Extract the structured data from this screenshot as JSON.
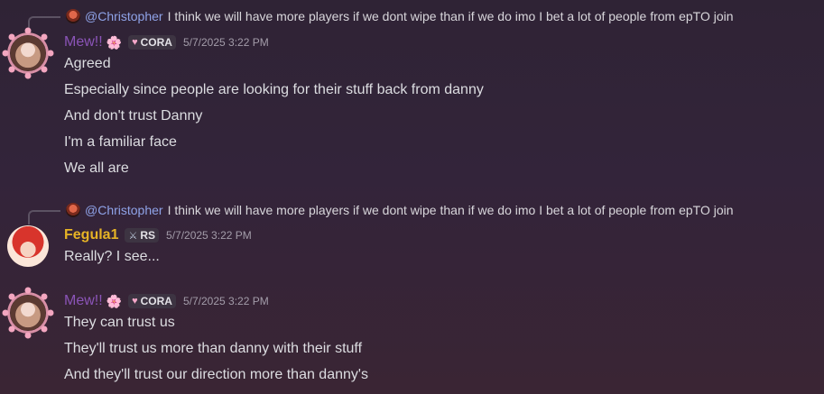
{
  "colors": {
    "mention": "#8fa3e8",
    "mew_name": "#8b54b8",
    "fegula_name": "#e6b325",
    "timestamp": "#a39ca9",
    "background": "#33243a"
  },
  "groups": [
    {
      "reply": {
        "mention": "@Christopher",
        "text": "I think we will have more players if we dont wipe than if we do imo I bet a lot of people from epTO join"
      },
      "author": "Mew!!",
      "author_emoji": "🌸",
      "tag_icon": "heart-icon",
      "tag": "CORA",
      "timestamp": "5/7/2025 3:22 PM",
      "messages": [
        "Agreed",
        "Especially since people are looking for their stuff back from danny",
        "And don't trust Danny",
        "I'm a familiar face",
        "We all are"
      ]
    },
    {
      "reply": {
        "mention": "@Christopher",
        "text": "I think we will have more players if we dont wipe than if we do imo I bet a lot of people from epTO join"
      },
      "author": "Fegula1",
      "tag_icon": "sword-icon",
      "tag": "RS",
      "timestamp": "5/7/2025 3:22 PM",
      "messages": [
        "Really? I see..."
      ]
    },
    {
      "author": "Mew!!",
      "author_emoji": "🌸",
      "tag_icon": "heart-icon",
      "tag": "CORA",
      "timestamp": "5/7/2025 3:22 PM",
      "messages": [
        "They can trust us",
        "They'll trust us more than danny with their stuff",
        "And they'll trust our direction more than danny's"
      ]
    }
  ]
}
